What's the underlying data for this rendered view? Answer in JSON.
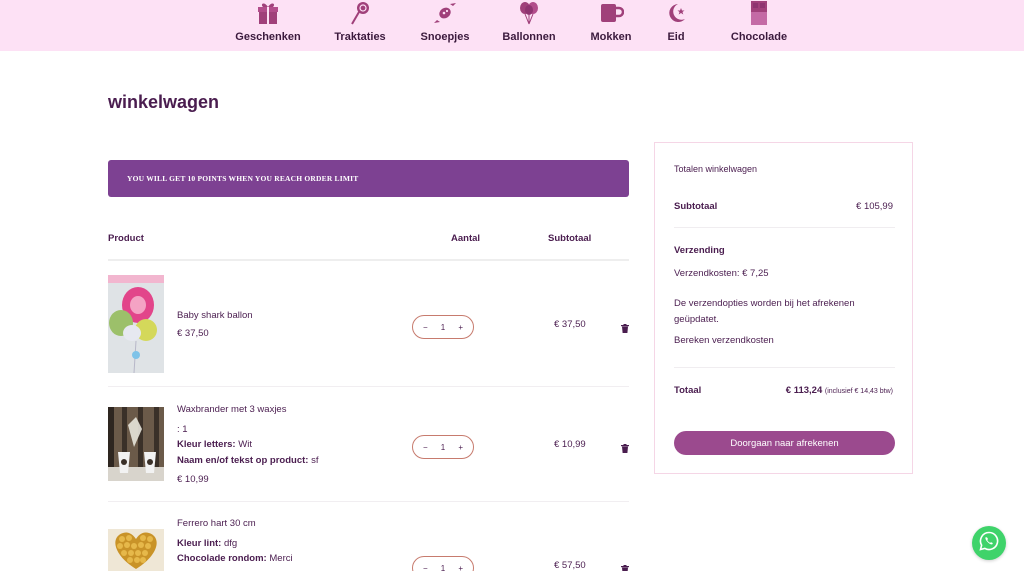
{
  "nav": {
    "items": [
      {
        "label": "Geschenken",
        "icon": "gift-icon"
      },
      {
        "label": "Traktaties",
        "icon": "lollipop-icon"
      },
      {
        "label": "Snoepjes",
        "icon": "candy-icon"
      },
      {
        "label": "Ballonnen",
        "icon": "balloons-icon"
      },
      {
        "label": "Mokken",
        "icon": "mug-icon"
      },
      {
        "label": "Eid",
        "icon": "crescent-star-icon"
      },
      {
        "label": "Chocolade",
        "icon": "chocolate-bar-icon"
      }
    ]
  },
  "page": {
    "title": "winkelwagen",
    "points_banner": "YOU WILL GET 10 POINTS WHEN YOU REACH ORDER LIMIT"
  },
  "cart": {
    "headers": {
      "product": "Product",
      "quantity": "Aantal",
      "subtotal": "Subtotaal"
    },
    "items": [
      {
        "name": "Baby shark ballon",
        "price": "€ 37,50",
        "quantity": "1",
        "subtotal": "€ 37,50",
        "meta": []
      },
      {
        "name": "Waxbrander met 3 waxjes",
        "price": "€ 10,99",
        "quantity": "1",
        "subtotal": "€ 10,99",
        "meta": [
          {
            "label": "",
            "value": ": 1"
          },
          {
            "label": "Kleur letters:",
            "value": "Wit"
          },
          {
            "label": "Naam en/of tekst op product:",
            "value": "sf"
          }
        ]
      },
      {
        "name": "Ferrero hart 30 cm",
        "price": "",
        "quantity": "1",
        "subtotal": "€ 57,50",
        "meta": [
          {
            "label": "Kleur lint:",
            "value": "dfg"
          },
          {
            "label": "Chocolade rondom:",
            "value": "Merci"
          }
        ]
      }
    ],
    "stepper": {
      "minus": "−",
      "plus": "+"
    }
  },
  "totals": {
    "title": "Totalen winkelwagen",
    "subtotal_label": "Subtotaal",
    "subtotal_value": "€ 105,99",
    "shipping_label": "Verzending",
    "shipping_cost": "Verzendkosten: € 7,25",
    "shipping_note": "De verzendopties worden bij het afrekenen geüpdatet.",
    "calc_shipping": "Bereken verzendkosten",
    "total_label": "Totaal",
    "total_value": "€ 113,24",
    "total_tax": "(inclusief € 14,43 btw)",
    "checkout_label": "Doorgaan naar afrekenen"
  },
  "colors": {
    "nav_bg": "#fde1f5",
    "banner": "#7d4192",
    "button": "#9b4a8e",
    "text": "#4a1d4f",
    "whatsapp": "#3fd36a"
  }
}
